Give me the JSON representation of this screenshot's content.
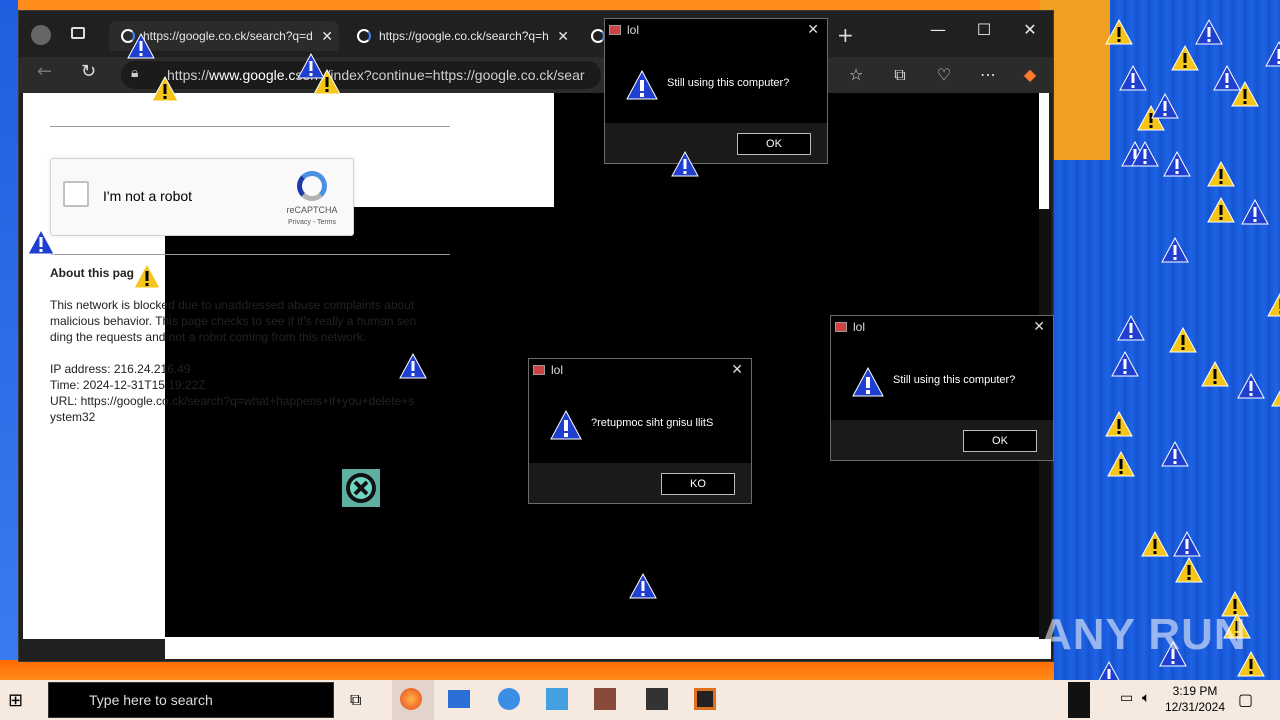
{
  "browser": {
    "tabs": [
      {
        "label": "https://google.co.ck/search?q=d"
      },
      {
        "label": "https://google.co.ck/search?q=h"
      }
    ],
    "address_prefix": "https://",
    "address_domain": "www.google.c",
    "address_rest": "sorry/index?continue=https://google.co.ck/sear"
  },
  "page": {
    "captcha_label": "I'm not a robot",
    "captcha_brand": "reCAPTCHA",
    "captcha_links": "Privacy - Terms",
    "about_heading": "About this pag",
    "body_lines": [
      "This network is blocked due to unaddressed abuse complaints about",
      "malicious behavior. This page checks to see if it's really a human sen",
      "ding the requests and not a robot coming from this network."
    ],
    "ip_line": "IP address: 216.24.216.49",
    "time_line": "Time: 2024-12-31T15:19:22Z",
    "url_line_1": "URL: https://google.co.ck/search?q=what+happens+if+you+delete+s",
    "url_line_2": "ystem32"
  },
  "dialogs": [
    {
      "title": "lol",
      "message": "Still using this computer?",
      "button": "OK"
    },
    {
      "title": "lol",
      "message": "?retupmoc siht gnisu llitS",
      "button": "KO"
    },
    {
      "title": "lol",
      "message": "Still using this computer?",
      "button": "OK"
    }
  ],
  "taskbar": {
    "search_placeholder": "Type here to search",
    "time": "3:19 PM",
    "date": "12/31/2024"
  },
  "watermark": "ANY RUN",
  "colors": {
    "desktop_blue": "#1857d8",
    "desktop_orange": "#ff8c1a",
    "warning_yellow": "#f5c518",
    "alert_blue": "#1f3fd1"
  }
}
